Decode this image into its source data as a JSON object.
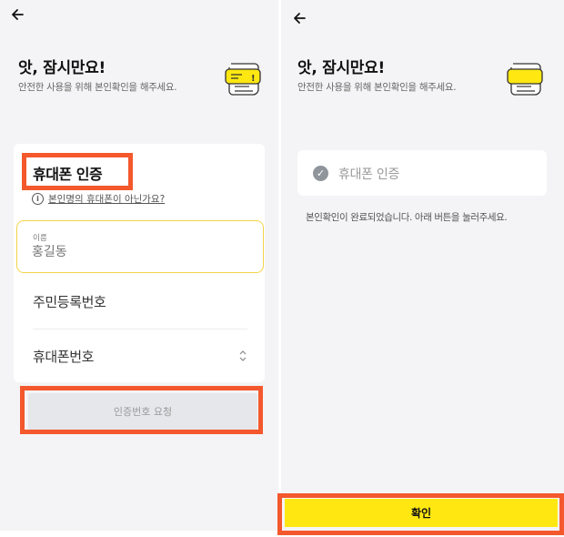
{
  "colors": {
    "highlight": "#f4582d",
    "accent_yellow": "#ffe812",
    "field_focus_border": "#f2d44a",
    "background": "#f4f4f6"
  },
  "left": {
    "back_icon": "back-arrow-icon",
    "title": "앗, 잠시만요!",
    "subtitle": "안전한 사용을 위해 본인확인을 해주세요.",
    "illustration_icon": "document-alert-icon",
    "verify_title": "휴대폰 인증",
    "helper_icon": "info-icon",
    "helper_link": "본인명의 휴대폰이 아닌가요?",
    "name_label": "이름",
    "name_placeholder": "홍길동",
    "id_number_label": "주민등록번호",
    "phone_label": "휴대폰번호",
    "carrier_icon": "chevron-up-down-icon",
    "request_button": "인증번호 요청"
  },
  "right": {
    "back_icon": "back-arrow-icon",
    "title": "앗, 잠시만요!",
    "subtitle": "안전한 사용을 위해 본인확인을 해주세요.",
    "illustration_icon": "document-alert-icon",
    "verified_icon": "check-circle-icon",
    "verified_label": "휴대폰 인증",
    "done_message": "본인확인이 완료되었습니다. 아래 버튼을 눌러주세요.",
    "confirm_button": "확인"
  }
}
